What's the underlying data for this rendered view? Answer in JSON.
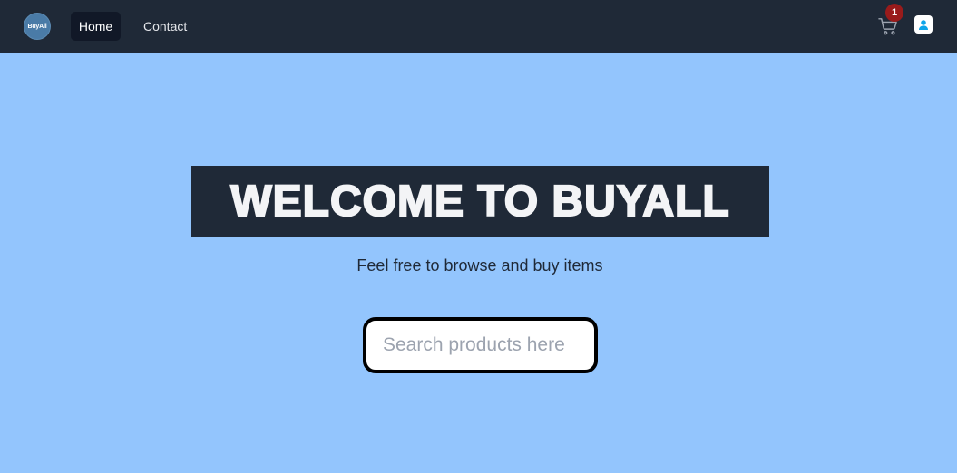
{
  "nav": {
    "logo_text": "BuyAll",
    "links": [
      {
        "label": "Home",
        "active": true
      },
      {
        "label": "Contact",
        "active": false
      }
    ],
    "cart_count": "1",
    "cart_icon": "cart-icon",
    "user_icon": "user-icon"
  },
  "hero": {
    "title": "WELCOME TO BUYALL",
    "subtitle": "Feel free to browse and buy items"
  },
  "search": {
    "placeholder": "Search products here",
    "value": ""
  },
  "colors": {
    "navbar": "#1f2937",
    "background": "#93c5fd",
    "badge": "#991b1b",
    "title_box": "#1f2937"
  }
}
